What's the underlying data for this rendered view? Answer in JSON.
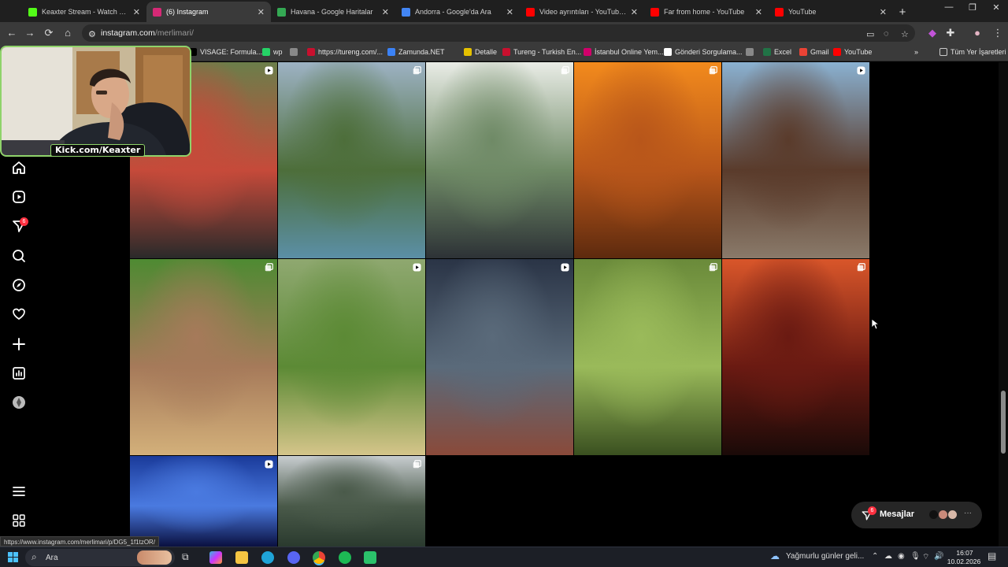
{
  "tabs": [
    {
      "title": "Keaxter Stream - Watch Live on",
      "favicon_color": "#53fc18"
    },
    {
      "title": "(6) Instagram",
      "favicon_color": "#d62976",
      "active": true
    },
    {
      "title": "Havana - Google Haritalar",
      "favicon_color": "#34a853"
    },
    {
      "title": "Andorra - Google'da Ara",
      "favicon_color": "#4285f4"
    },
    {
      "title": "Video ayrıntıları - YouTube Stu",
      "favicon_color": "#ff0000"
    },
    {
      "title": "Far from home - YouTube",
      "favicon_color": "#ff0000"
    },
    {
      "title": "YouTube",
      "favicon_color": "#ff0000"
    }
  ],
  "address": {
    "host": "instagram.com",
    "path": "/merlimari/"
  },
  "bookmarks": [
    {
      "label": "VISAGE: Formula...",
      "icon_color": "#000000"
    },
    {
      "label": "wp",
      "icon_color": "#25d366"
    },
    {
      "label": "",
      "icon_color": "#888888"
    },
    {
      "label": "https://tureng.com/...",
      "icon_color": "#c8102e"
    },
    {
      "label": "Zamunda.NET",
      "icon_color": "#3b82f6"
    },
    {
      "label": "Detalle",
      "icon_color": "#e5c100"
    },
    {
      "label": "Tureng - Turkish En...",
      "icon_color": "#c8102e"
    },
    {
      "label": "İstanbul Online Yem...",
      "icon_color": "#d1006b"
    },
    {
      "label": "Gönderi Sorgulama...",
      "icon_color": "#ffffff"
    },
    {
      "label": "",
      "icon_color": "#888888"
    },
    {
      "label": "Excel",
      "icon_color": "#217346"
    },
    {
      "label": "Gmail",
      "icon_color": "#ea4335"
    },
    {
      "label": "YouTube",
      "icon_color": "#ff0000"
    }
  ],
  "bookmarks_all": "Tüm Yer İşaretleri",
  "sidenav": {
    "notification_count": "6"
  },
  "overlay": {
    "kick_label": "Kick.com/Keaxter"
  },
  "messages": {
    "label": "Mesajlar",
    "count": "6",
    "more": "···"
  },
  "status_url": "https://www.instagram.com/merlimari/p/DG5_1f1tzOR/",
  "taskbar": {
    "search_placeholder": "Ara",
    "weather": "Yağmurlu günler geli...",
    "time": "16:07",
    "date": "10.02.2026"
  },
  "scroll": {
    "position_fraction": 0.78,
    "thumb_fraction": 0.13
  },
  "posts": [
    {
      "name": "post-friends-sunglasses",
      "scene": "two friends in sunglasses",
      "colors": [
        "#6b7e4a",
        "#c64a3a",
        "#2a2a2a"
      ],
      "type": "reel"
    },
    {
      "name": "post-river-village",
      "scene": "river village with vineyards",
      "colors": [
        "#9db2c4",
        "#4d6e3a",
        "#5b8fa6"
      ],
      "type": "carousel"
    },
    {
      "name": "post-woman-in-lake",
      "scene": "woman standing in a lake",
      "colors": [
        "#e9ece6",
        "#6f8a66",
        "#2d3236"
      ],
      "type": "carousel"
    },
    {
      "name": "post-orange-sunset",
      "scene": "orange foggy sunset",
      "colors": [
        "#f28a1c",
        "#b8561a",
        "#5d2a0e"
      ],
      "type": "carousel"
    },
    {
      "name": "post-woman-red-drink",
      "scene": "woman holding a red drink",
      "colors": [
        "#8ab1d1",
        "#5a3b2b",
        "#8a7a6a"
      ],
      "type": "reel"
    },
    {
      "name": "post-friends-park",
      "scene": "friends sitting in a park",
      "colors": [
        "#4e8a32",
        "#a67a5a",
        "#d3b07a"
      ],
      "type": "carousel"
    },
    {
      "name": "post-woman-green-field",
      "scene": "woman walking in a green field",
      "colors": [
        "#8fa870",
        "#5c8a35",
        "#d5c58a"
      ],
      "type": "reel"
    },
    {
      "name": "post-concert-river",
      "scene": "concert crowd by a river at night",
      "colors": [
        "#2a3446",
        "#5a6a7a",
        "#8a4a3a"
      ],
      "type": "reel"
    },
    {
      "name": "post-forest-path",
      "scene": "forest path with railing",
      "colors": [
        "#6a8a3a",
        "#9aba5a",
        "#3a5020"
      ],
      "type": "carousel"
    },
    {
      "name": "post-singing-red",
      "scene": "singing with microphone in red light",
      "colors": [
        "#d9562a",
        "#6a1a12",
        "#1a0a08"
      ],
      "type": "carousel"
    },
    {
      "name": "post-blue-concert",
      "scene": "blue stage concert",
      "colors": [
        "#1a3a9a",
        "#4a7ae0",
        "#0a1040"
      ],
      "type": "reel"
    },
    {
      "name": "post-misty-forest",
      "scene": "misty pine forest",
      "colors": [
        "#c8cdd0",
        "#4a5a4a",
        "#2a3a2e"
      ],
      "type": "carousel"
    }
  ]
}
